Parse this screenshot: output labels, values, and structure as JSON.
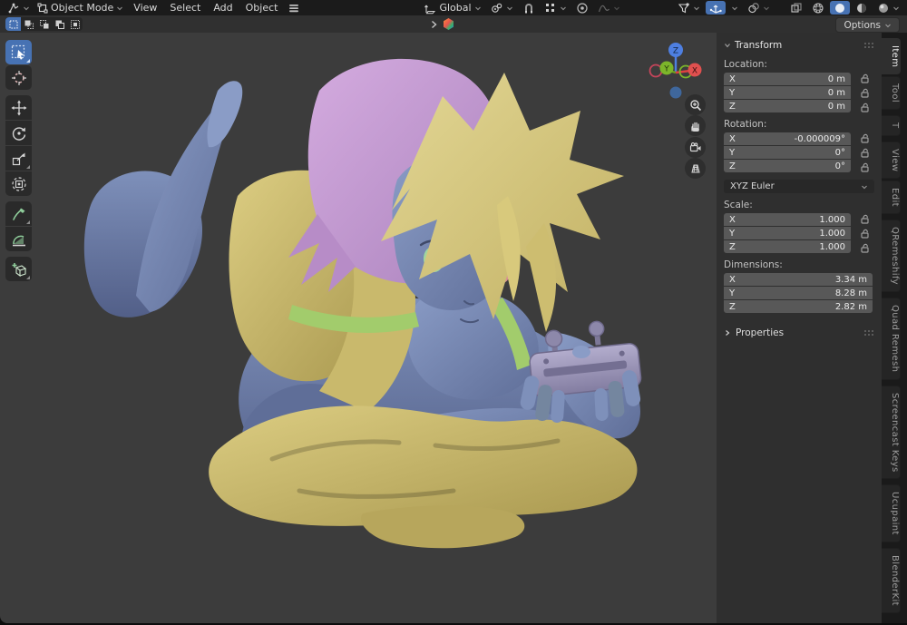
{
  "header": {
    "mode_label": "Object Mode",
    "menus": {
      "view": "View",
      "select": "Select",
      "add": "Add",
      "object": "Object"
    },
    "orientation_label": "Global"
  },
  "toolbar": {
    "options_label": "Options"
  },
  "tool_shelf": {
    "tools": [
      "select-box",
      "cursor",
      "move",
      "rotate",
      "scale",
      "transform",
      "annotate",
      "measure",
      "add-cube"
    ],
    "active_tool": "select-box"
  },
  "viewport": {
    "gizmo_axes": {
      "x": "X",
      "y": "Y",
      "z": "Z"
    },
    "view_buttons": [
      "zoom",
      "pan",
      "camera-view",
      "toggle-projection"
    ]
  },
  "sidebar": {
    "active_tab": "Item",
    "tabs": {
      "item": "Item",
      "tool": "Tool",
      "t": "T",
      "view": "View",
      "edit": "Edit",
      "qremeshify": "QRemeshify",
      "quad_remesh": "Quad Remesh",
      "screencast_keys": "Screencast Keys",
      "ucupaint": "Ucupaint",
      "blenderkit": "BlenderKit"
    },
    "transform": {
      "title": "Transform",
      "location_label": "Location:",
      "location": {
        "x": {
          "axis": "X",
          "value": "0 m"
        },
        "y": {
          "axis": "Y",
          "value": "0 m"
        },
        "z": {
          "axis": "Z",
          "value": "0 m"
        }
      },
      "rotation_label": "Rotation:",
      "rotation": {
        "x": {
          "axis": "X",
          "value": "-0.000009°"
        },
        "y": {
          "axis": "Y",
          "value": "0°"
        },
        "z": {
          "axis": "Z",
          "value": "0°"
        }
      },
      "rotation_mode": "XYZ Euler",
      "scale_label": "Scale:",
      "scale": {
        "x": {
          "axis": "X",
          "value": "1.000"
        },
        "y": {
          "axis": "Y",
          "value": "1.000"
        },
        "z": {
          "axis": "Z",
          "value": "1.000"
        }
      },
      "dimensions_label": "Dimensions:",
      "dimensions": {
        "x": {
          "axis": "X",
          "value": "3.34 m"
        },
        "y": {
          "axis": "Y",
          "value": "8.28 m"
        },
        "z": {
          "axis": "Z",
          "value": "2.82 m"
        }
      }
    },
    "properties_title": "Properties"
  },
  "colors": {
    "accent_blue": "#4772b3",
    "viewport_bg": "#3c3c3c",
    "panel_bg": "#2f2f2f",
    "header_bg": "#1b1b1b",
    "axis_x_red": "#e0403f",
    "axis_y_green": "#6fa21c",
    "axis_z_blue": "#3f7fde",
    "model_skin": "#7e90ba",
    "model_hair_pink": "#c79fd4",
    "model_hair_blonde": "#d9cc84",
    "model_cloth_yellow": "#cfc075",
    "model_strap_green": "#a2cc6c",
    "model_controller": "#9d97b8",
    "model_eye_left": "#9fd6a0",
    "model_eye_right": "#d98f93"
  }
}
